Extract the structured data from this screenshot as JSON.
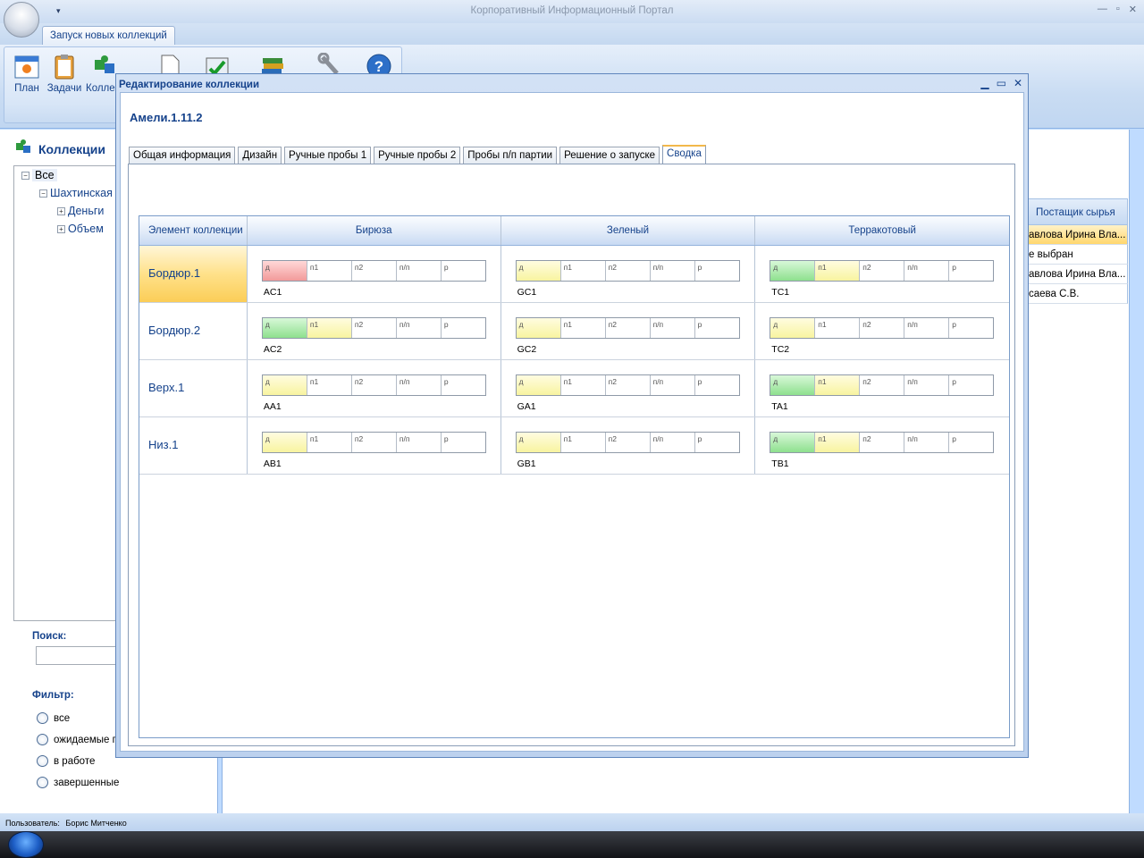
{
  "app": {
    "title": "Корпоративный Информационный Портал"
  },
  "ribbon": {
    "tab": "Запуск новых коллекций",
    "buttons": [
      {
        "label": "План",
        "icon": "calendar-icon"
      },
      {
        "label": "Задачи",
        "icon": "clipboard-icon"
      },
      {
        "label": "Колле",
        "icon": "puzzle-icon"
      },
      {
        "label": "",
        "icon": "document-icon"
      },
      {
        "label": "",
        "icon": "checklist-icon"
      },
      {
        "label": "",
        "icon": "books-icon"
      },
      {
        "label": "",
        "icon": "wrench-icon"
      },
      {
        "label": "",
        "icon": "help-icon"
      }
    ]
  },
  "left_panel": {
    "title": "Коллекции",
    "tree": [
      {
        "label": "Все",
        "expander": "−"
      },
      {
        "label": "Шахтинская",
        "expander": "−"
      },
      {
        "label": "Деньги",
        "expander": "+"
      },
      {
        "label": "Объем",
        "expander": "+"
      }
    ],
    "search_label": "Поиск:",
    "search_value": "",
    "filter_label": "Фильтр:",
    "filters": [
      "все",
      "ожидаемые п",
      "в работе",
      "завершенные"
    ]
  },
  "background_grid": {
    "header": "Постащик сырья",
    "rows": [
      "авлова Ирина Вла...",
      "е выбран",
      "авлова Ирина Вла...",
      "саева С.В."
    ]
  },
  "status": {
    "user_label": "Пользователь:",
    "user": "Борис Митченко"
  },
  "dialog": {
    "title": "Редактирование коллекции",
    "collection": "Амели.1.11.2",
    "tabs": [
      "Общая информация",
      "Дизайн",
      "Ручные пробы 1",
      "Ручные пробы 2",
      "Пробы п/п партии",
      "Решение о запуске",
      "Сводка"
    ],
    "active_tab": "Сводка",
    "matrix": {
      "first_header": "Элемент коллекции",
      "stage_labels": [
        "д",
        "п1",
        "п2",
        "п/п",
        "р"
      ],
      "colors": [
        "Бирюза",
        "Зеленый",
        "Терракотовый"
      ],
      "rows": [
        {
          "element": "Бордюр.1",
          "cells": [
            {
              "code": "AC1",
              "states": [
                "red",
                "",
                "",
                "",
                ""
              ]
            },
            {
              "code": "GC1",
              "states": [
                "yellow",
                "",
                "",
                "",
                ""
              ]
            },
            {
              "code": "TC1",
              "states": [
                "green",
                "yellow",
                "",
                "",
                ""
              ]
            }
          ]
        },
        {
          "element": "Бордюр.2",
          "cells": [
            {
              "code": "AC2",
              "states": [
                "green",
                "yellow",
                "",
                "",
                ""
              ]
            },
            {
              "code": "GC2",
              "states": [
                "yellow",
                "",
                "",
                "",
                ""
              ]
            },
            {
              "code": "TC2",
              "states": [
                "yellow",
                "",
                "",
                "",
                ""
              ]
            }
          ]
        },
        {
          "element": "Верх.1",
          "cells": [
            {
              "code": "AA1",
              "states": [
                "yellow",
                "",
                "",
                "",
                ""
              ]
            },
            {
              "code": "GA1",
              "states": [
                "yellow",
                "",
                "",
                "",
                ""
              ]
            },
            {
              "code": "TA1",
              "states": [
                "green",
                "yellow",
                "",
                "",
                ""
              ]
            }
          ]
        },
        {
          "element": "Низ.1",
          "cells": [
            {
              "code": "AB1",
              "states": [
                "yellow",
                "",
                "",
                "",
                ""
              ]
            },
            {
              "code": "GB1",
              "states": [
                "yellow",
                "",
                "",
                "",
                ""
              ]
            },
            {
              "code": "TB1",
              "states": [
                "green",
                "yellow",
                "",
                "",
                ""
              ]
            }
          ]
        }
      ]
    }
  }
}
